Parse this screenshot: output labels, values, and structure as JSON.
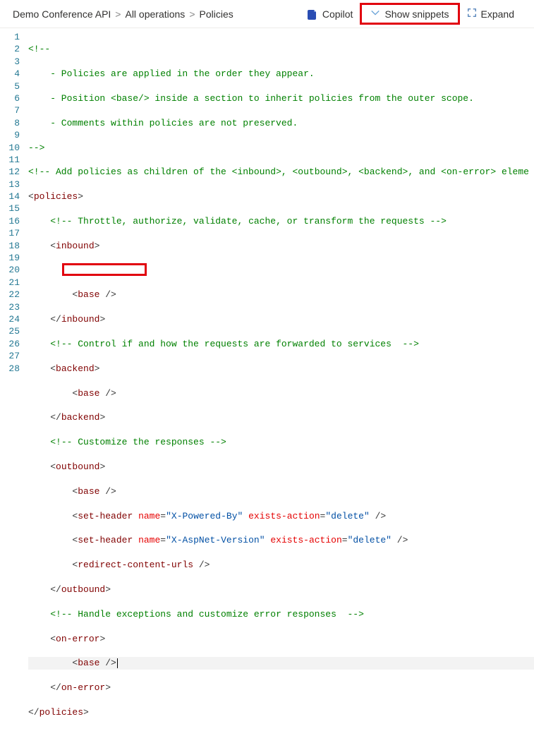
{
  "breadcrumb": {
    "item1": "Demo Conference API",
    "item2": "All operations",
    "item3": "Policies",
    "sep": ">"
  },
  "actions": {
    "copilot": "Copilot",
    "snippets": "Show snippets",
    "expand": "Expand"
  },
  "code": {
    "l1": "<!--",
    "l2": "    - Policies are applied in the order they appear.",
    "l3": "    - Position <base/> inside a section to inherit policies from the outer scope.",
    "l4": "    - Comments within policies are not preserved.",
    "l5": "-->",
    "l6a": "<!-- Add policies as children of the ",
    "l6b": "<inbound>",
    "l6c": ", ",
    "l6d": "<outbound>",
    "l6e": ", ",
    "l6f": "<backend>",
    "l6g": ", and ",
    "l6h": "<on-error>",
    "l6i": " eleme",
    "l7": "policies",
    "l8": "<!-- Throttle, authorize, validate, cache, or transform the requests -->",
    "l9": "inbound",
    "l11tag": "base",
    "l12": "inbound",
    "l13": "<!-- Control if and how the requests are forwarded to services  -->",
    "l14": "backend",
    "l15tag": "base",
    "l16": "backend",
    "l17": "<!-- Customize the responses -->",
    "l18": "outbound",
    "l19tag": "base",
    "l20tag": "set-header",
    "l20name_attr": "name",
    "l20name_val": "\"X-Powered-By\"",
    "l20ea_attr": "exists-action",
    "l20ea_val": "\"delete\"",
    "l21name_val": "\"X-AspNet-Version\"",
    "l22tag": "redirect-content-urls",
    "l23": "outbound",
    "l24": "<!-- Handle exceptions and customize error responses  -->",
    "l25": "on-error",
    "l26tag": "base",
    "l27": "on-error",
    "l28": "policies"
  },
  "line_numbers": [
    "1",
    "2",
    "3",
    "4",
    "5",
    "6",
    "7",
    "8",
    "9",
    "10",
    "11",
    "12",
    "13",
    "14",
    "15",
    "16",
    "17",
    "18",
    "19",
    "20",
    "21",
    "22",
    "23",
    "24",
    "25",
    "26",
    "27",
    "28"
  ]
}
